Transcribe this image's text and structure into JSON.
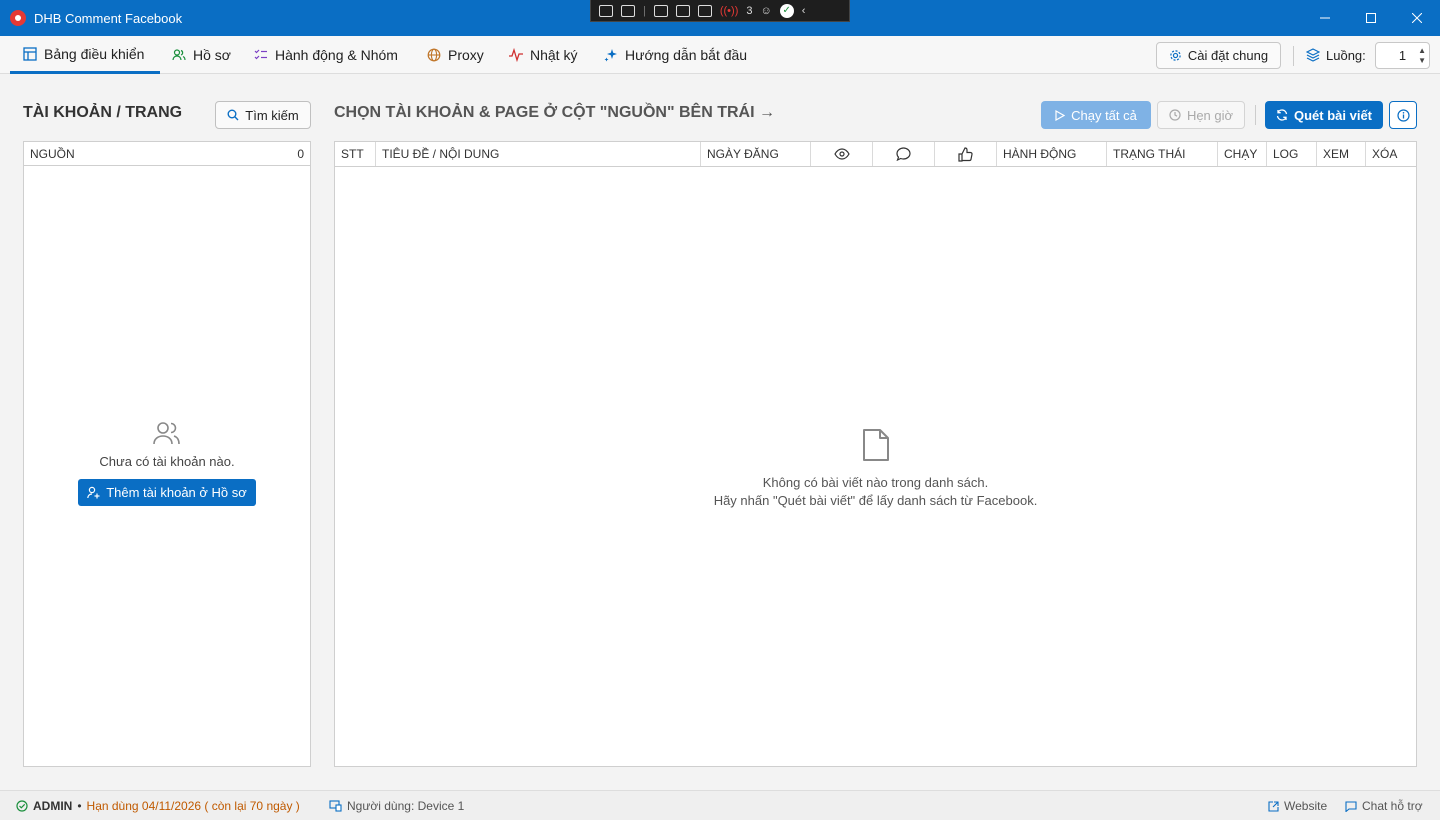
{
  "window": {
    "title": "DHB Comment Facebook",
    "minimize_icon": "minimize-icon",
    "maximize_icon": "maximize-icon",
    "close_icon": "close-icon"
  },
  "devtools": {
    "badge_count": "3"
  },
  "tabs": [
    {
      "label": "Bảng điều khiển",
      "icon": "grid-icon",
      "active": true
    },
    {
      "label": "Hồ sơ",
      "icon": "users-icon"
    },
    {
      "label": "Hành động & Nhóm",
      "icon": "checklist-icon"
    },
    {
      "label": "Proxy",
      "icon": "globe-icon"
    },
    {
      "label": "Nhật ký",
      "icon": "activity-icon"
    },
    {
      "label": "Hướng dẫn bắt đầu",
      "icon": "sparkle-icon"
    }
  ],
  "header_right": {
    "settings_label": "Cài đặt chung",
    "threads_label": "Luồng:",
    "threads_value": "1"
  },
  "left": {
    "title": "TÀI KHOẢN / TRANG",
    "search_label": "Tìm kiếm",
    "column_label": "NGUỒN",
    "count": "0",
    "empty_message": "Chưa có tài khoản nào.",
    "add_button_label": "Thêm tài khoản ở Hồ sơ"
  },
  "right": {
    "title": "CHỌN TÀI KHOẢN & PAGE Ở CỘT \"NGUỒN\" BÊN TRÁI →",
    "run_all_label": "Chạy tất cả",
    "schedule_label": "Hẹn giờ",
    "scan_label": "Quét bài viết",
    "columns": [
      "STT",
      "TIÊU ĐỀ / NỘI DUNG",
      "NGÀY ĐĂNG",
      "",
      "",
      "",
      "HÀNH ĐỘNG",
      "TRẠNG THÁI",
      "CHẠY",
      "LOG",
      "XEM",
      "XÓA"
    ],
    "empty_line1": "Không có bài viết nào trong danh sách.",
    "empty_line2": "Hãy nhấn \"Quét bài viết\" để lấy danh sách từ Facebook."
  },
  "status": {
    "user": "ADMIN",
    "expiry": "Hạn dùng 04/11/2026 ( còn lại 70 ngày )",
    "device": "Người dùng: Device 1",
    "website_label": "Website",
    "support_label": "Chat hỗ trợ"
  },
  "colors": {
    "accent": "#0a6ec4",
    "expiry": "#c05a00",
    "ok": "#1a8f3c"
  }
}
